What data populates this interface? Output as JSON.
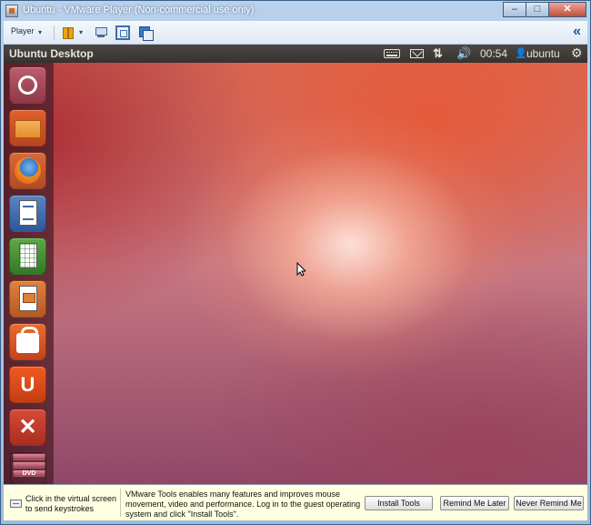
{
  "window": {
    "title": "Ubuntu - VMware Player (Non-commercial use only)",
    "buttons": {
      "minimize": "–",
      "maximize": "□",
      "close": "✕"
    }
  },
  "toolbar": {
    "player_label": "Player",
    "player_caret": "▾",
    "pause_caret": "▾",
    "collapse_icon": "«"
  },
  "top_panel": {
    "title": "Ubuntu Desktop",
    "indicators": {
      "network_glyph": "⇅",
      "volume_glyph": "🔊",
      "clock": "00:54",
      "user_glyph": "👤",
      "user": "ubuntu",
      "session_glyph": "⚙"
    }
  },
  "launcher": {
    "items": [
      {
        "name": "Dash Home",
        "icon": "ubuntu-logo-icon"
      },
      {
        "name": "Home Folder",
        "icon": "folder-icon"
      },
      {
        "name": "Firefox Web Browser",
        "icon": "firefox-icon"
      },
      {
        "name": "LibreOffice Writer",
        "icon": "writer-icon"
      },
      {
        "name": "LibreOffice Calc",
        "icon": "calc-icon"
      },
      {
        "name": "LibreOffice Impress",
        "icon": "impress-icon"
      },
      {
        "name": "Ubuntu Software Center",
        "icon": "software-center-icon"
      },
      {
        "name": "Ubuntu One",
        "icon": "ubuntu-one-icon",
        "glyph": "U"
      },
      {
        "name": "System Settings",
        "icon": "system-settings-icon",
        "glyph": "✕"
      },
      {
        "name": "Workspace Stack",
        "icon": "dvd-stack-icon",
        "glyph": "DVD"
      }
    ]
  },
  "notification": {
    "left_text": "Click in the virtual screen to send keystrokes",
    "message": "VMware Tools enables many features and improves mouse movement, video and performance. Log in to the guest operating system and click \"Install Tools\".",
    "install_button": "Install Tools",
    "remind_later_button": "Remind Me Later",
    "never_remind_button": "Never Remind Me"
  },
  "colors": {
    "panel": "#3f3c39",
    "desktop_highlight": "#f6d6cc",
    "desktop_accent": "#e0644a",
    "notification_bg": "#ffffe1"
  }
}
